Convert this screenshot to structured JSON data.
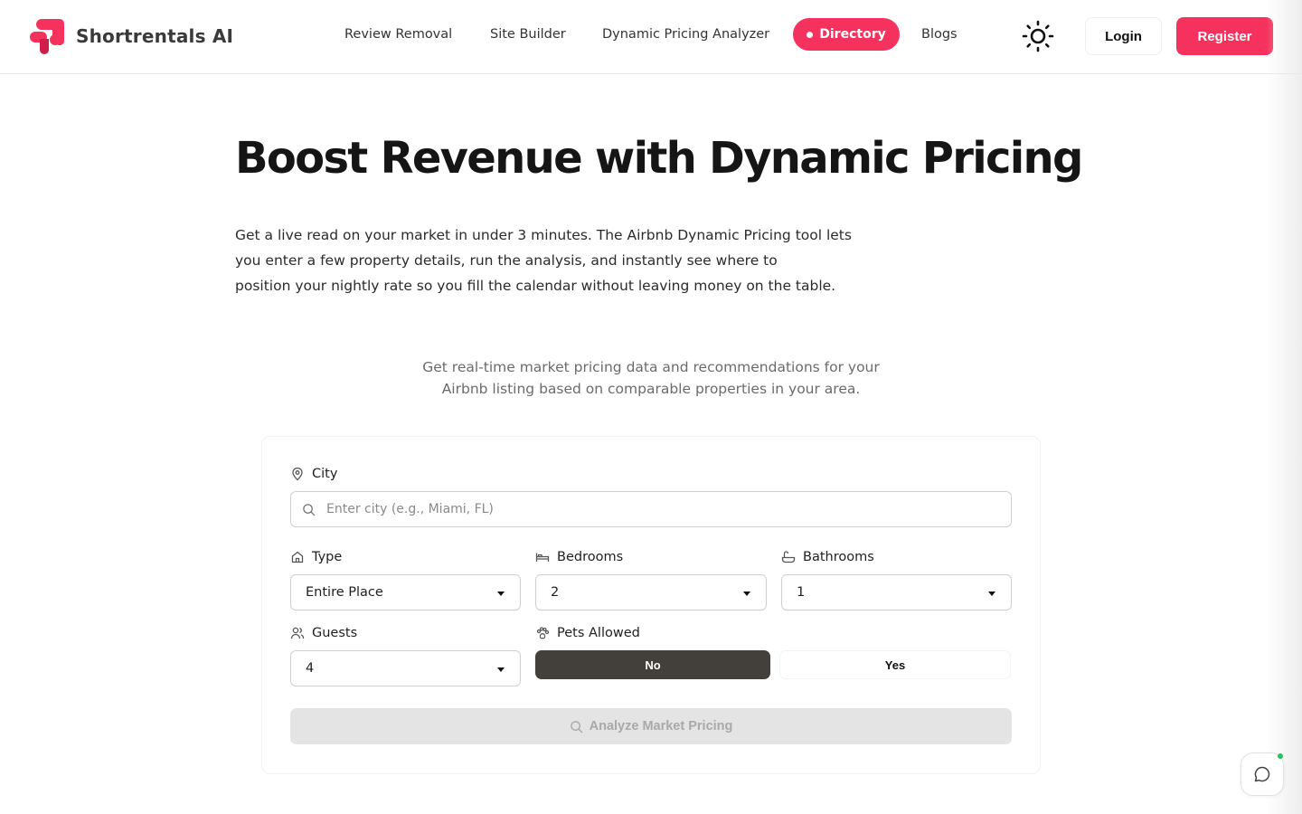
{
  "brand": {
    "name": "Shortrentals AI",
    "accent": "#f5325d"
  },
  "nav": {
    "items": [
      "Review Removal",
      "Site Builder",
      "Dynamic Pricing Analyzer",
      "Directory",
      "Blogs"
    ],
    "login": "Login",
    "register": "Register",
    "theme_icon": "sun-icon"
  },
  "hero": {
    "title": "Boost Revenue with Dynamic Pricing",
    "description": [
      "Get a live read on your market in under 3 minutes. The Airbnb Dynamic Pricing tool lets",
      "you enter a few property details, run the analysis, and instantly see where to",
      "position your nightly rate so you fill the calendar without leaving money on the table."
    ],
    "subdescription": [
      "Get real-time market pricing data and recommendations for your",
      "Airbnb listing based on comparable properties in your area."
    ]
  },
  "form": {
    "city": {
      "label": "City",
      "placeholder": "Enter city (e.g., Miami, FL)",
      "value": ""
    },
    "type": {
      "label": "Type",
      "value": "Entire Place"
    },
    "bedrooms": {
      "label": "Bedrooms",
      "value": "2"
    },
    "bathrooms": {
      "label": "Bathrooms",
      "value": "1"
    },
    "guests": {
      "label": "Guests",
      "value": "4"
    },
    "pets": {
      "label": "Pets Allowed",
      "options": [
        "No",
        "Yes"
      ],
      "selected": "No"
    },
    "submit": "Analyze Market Pricing"
  },
  "chat": {
    "icon": "chat-bubble-icon",
    "status_color": "#22c55e"
  }
}
